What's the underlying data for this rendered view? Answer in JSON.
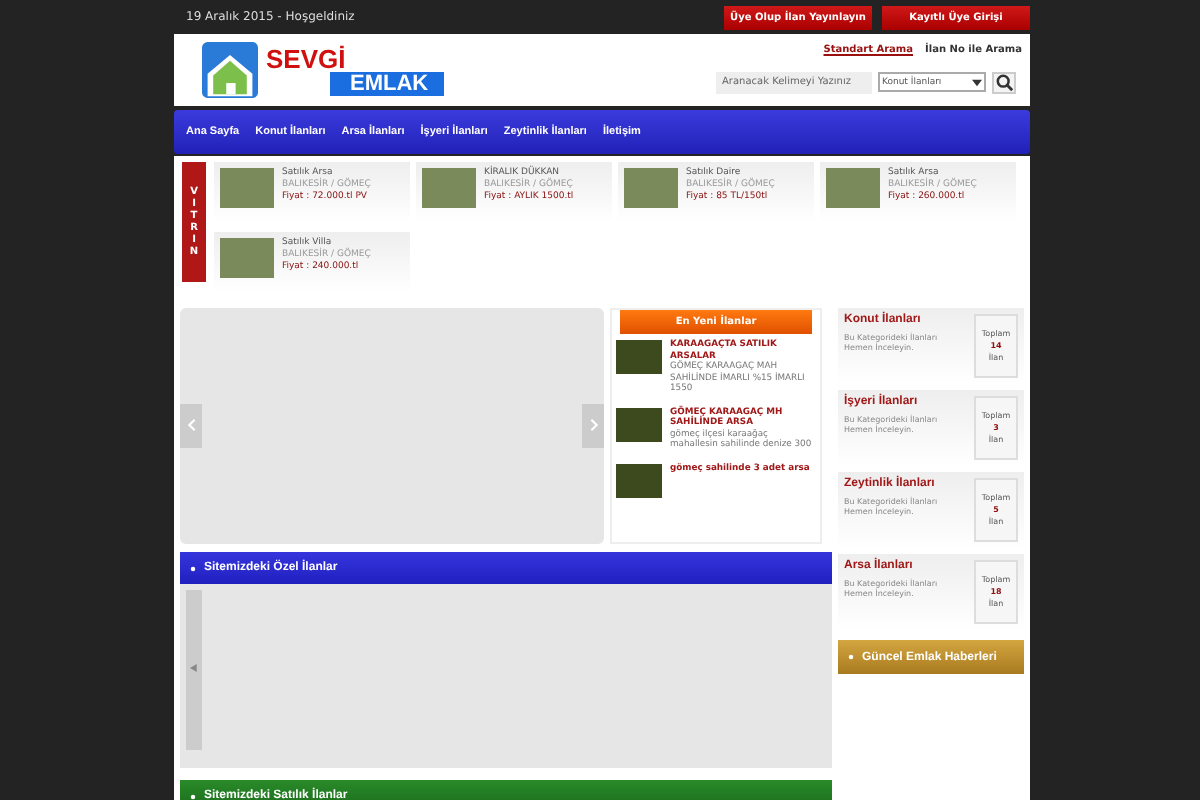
{
  "top_bar": {
    "date_text": "19 Aralık 2015 - Hoşgeldiniz",
    "buttons": [
      "Üye Olup İlan Yayınlayın",
      "Kayıtlı Üye Girişi"
    ]
  },
  "header": {
    "logo_top": "SEVGİ",
    "logo_bottom": "EMLAK",
    "search_tabs": [
      {
        "label": "Standart Arama",
        "selected": true
      },
      {
        "label": "İlan No ile Arama",
        "selected": false
      }
    ],
    "search": {
      "placeholder": "Aranacak Kelimeyi Yazınız"
    },
    "category_select": "Konut İlanları"
  },
  "nav": [
    "Ana Sayfa",
    "Konut İlanları",
    "Arsa İlanları",
    "İşyeri İlanları",
    "Zeytinlik İlanları",
    "İletişim"
  ],
  "vitrin": {
    "ribbon": "VITRIN",
    "items": [
      {
        "title": "Satılık Arsa",
        "location": "BALIKESİR / GÖMEÇ",
        "price": "Fiyat : 72.000.tl PV"
      },
      {
        "title": "KİRALIK DÜKKAN",
        "location": "BALIKESİR / GÖMEÇ",
        "price": "Fiyat : AYLIK 1500.tl"
      },
      {
        "title": "Satılık Daire",
        "location": "BALIKESİR / GÖMEÇ",
        "price": "Fiyat : 85 TL/150tl"
      },
      {
        "title": "Satılık Arsa",
        "location": "BALIKESİR / GÖMEÇ",
        "price": "Fiyat : 260.000.tl"
      },
      {
        "title": "Satılık Villa",
        "location": "BALIKESİR / GÖMEÇ",
        "price": "Fiyat : 240.000.tl"
      }
    ]
  },
  "latest": {
    "title": "En Yeni İlanlar",
    "items": [
      {
        "title": "KARAAGAÇTA SATILIK ARSALAR",
        "text": "GÖMEÇ KARAAGAÇ MAH SAHİLİNDE İMARLI %15 İMARLI 1550"
      },
      {
        "title": "GÖMEÇ KARAAGAÇ MH SAHİLİNDE ARSA",
        "text": "gömeç ilçesi karaağaç mahallesin sahilinde denize 300"
      },
      {
        "title": "gömeç sahilinde 3 adet arsa"
      }
    ]
  },
  "sections": [
    {
      "title": "Sitemizdeki Özel İlanlar",
      "kind": "blue"
    },
    {
      "title": "Sitemizdeki Satılık İlanlar",
      "kind": "green"
    }
  ],
  "categories": [
    {
      "title": "Konut İlanları",
      "text": "Bu Kategorideki İlanları Hemen İnceleyin.",
      "total_label": "Toplam",
      "count": "14",
      "unit": "İlan"
    },
    {
      "title": "İşyeri İlanları",
      "text": "Bu Kategorideki İlanları Hemen İnceleyin.",
      "total_label": "Toplam",
      "count": "3",
      "unit": "İlan"
    },
    {
      "title": "Zeytinlik İlanları",
      "text": "Bu Kategorideki İlanları Hemen İnceleyin.",
      "total_label": "Toplam",
      "count": "5",
      "unit": "İlan"
    },
    {
      "title": "Arsa İlanları",
      "text": "Bu Kategorideki İlanları Hemen İnceleyin.",
      "total_label": "Toplam",
      "count": "18",
      "unit": "İlan"
    }
  ],
  "news_bar": "Güncel Emlak Haberleri"
}
